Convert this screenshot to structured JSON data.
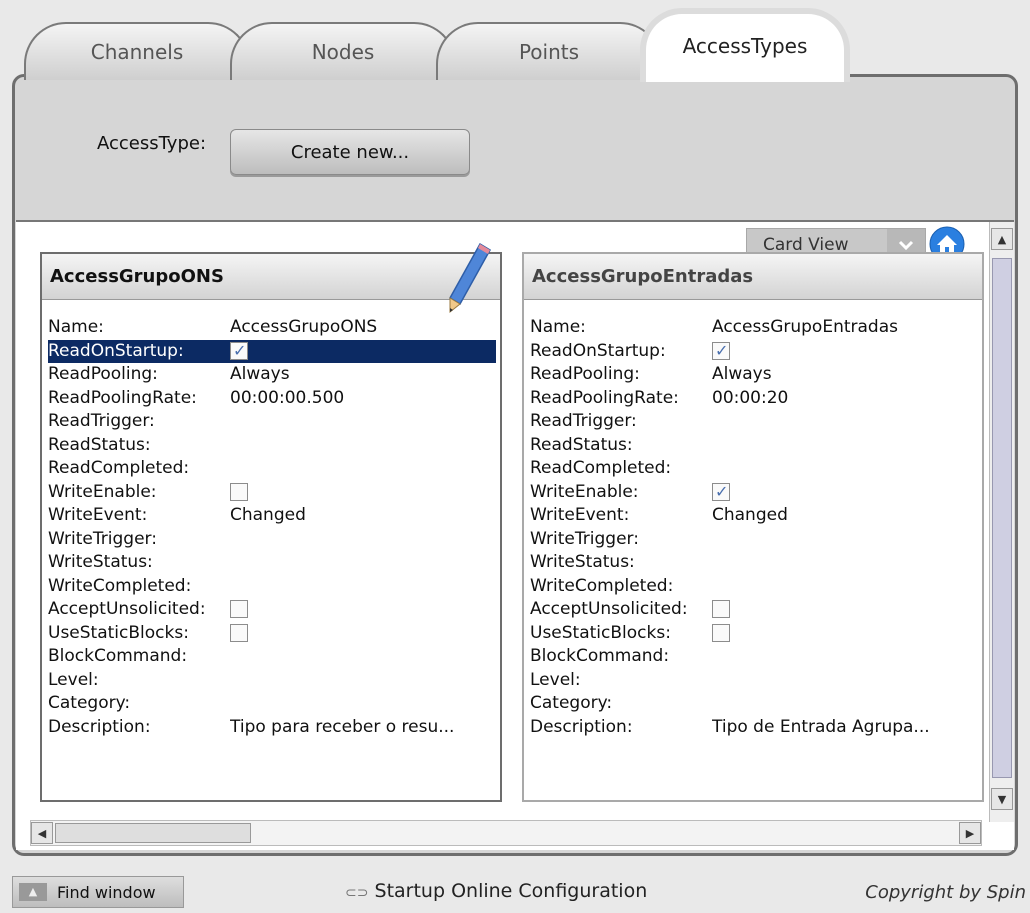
{
  "tabs": [
    "Channels",
    "Nodes",
    "Points",
    "AccessTypes"
  ],
  "accesstype_label": "AccessType:",
  "create_button": "Create new...",
  "view_selector": "Card View",
  "cards": [
    {
      "title": "AccessGrupoONS",
      "rows": [
        {
          "label": "Name:",
          "value": "AccessGrupoONS"
        },
        {
          "label": "ReadOnStartup:",
          "checkbox": true
        },
        {
          "label": "ReadPooling:",
          "value": "Always"
        },
        {
          "label": "ReadPoolingRate:",
          "value": "00:00:00.500"
        },
        {
          "label": "ReadTrigger:",
          "value": ""
        },
        {
          "label": "ReadStatus:",
          "value": ""
        },
        {
          "label": "ReadCompleted:",
          "value": ""
        },
        {
          "label": "WriteEnable:",
          "checkbox": false
        },
        {
          "label": "WriteEvent:",
          "value": "Changed"
        },
        {
          "label": "WriteTrigger:",
          "value": ""
        },
        {
          "label": "WriteStatus:",
          "value": ""
        },
        {
          "label": "WriteCompleted:",
          "value": ""
        },
        {
          "label": "AcceptUnsolicited:",
          "checkbox": false
        },
        {
          "label": "UseStaticBlocks:",
          "checkbox": false
        },
        {
          "label": "BlockCommand:",
          "value": ""
        },
        {
          "label": "Level:",
          "value": ""
        },
        {
          "label": "Category:",
          "value": ""
        },
        {
          "label": "Description:",
          "value": "Tipo para receber o resu..."
        }
      ]
    },
    {
      "title": "AccessGrupoEntradas",
      "rows": [
        {
          "label": "Name:",
          "value": "AccessGrupoEntradas"
        },
        {
          "label": "ReadOnStartup:",
          "checkbox": true
        },
        {
          "label": "ReadPooling:",
          "value": "Always"
        },
        {
          "label": "ReadPoolingRate:",
          "value": "00:00:20"
        },
        {
          "label": "ReadTrigger:",
          "value": ""
        },
        {
          "label": "ReadStatus:",
          "value": ""
        },
        {
          "label": "ReadCompleted:",
          "value": ""
        },
        {
          "label": "WriteEnable:",
          "checkbox": true
        },
        {
          "label": "WriteEvent:",
          "value": "Changed"
        },
        {
          "label": "WriteTrigger:",
          "value": ""
        },
        {
          "label": "WriteStatus:",
          "value": ""
        },
        {
          "label": "WriteCompleted:",
          "value": ""
        },
        {
          "label": "AcceptUnsolicited:",
          "checkbox": false
        },
        {
          "label": "UseStaticBlocks:",
          "checkbox": false
        },
        {
          "label": "BlockCommand:",
          "value": ""
        },
        {
          "label": "Level:",
          "value": ""
        },
        {
          "label": "Category:",
          "value": ""
        },
        {
          "label": "Description:",
          "value": "Tipo de Entrada Agrupa..."
        }
      ]
    }
  ],
  "footer": {
    "find_window": "Find window",
    "startup": "Startup Online Configuration",
    "copyright": "Copyright by Spin"
  },
  "colors": {
    "selection": "#0c2a63",
    "home_icon": "#2a7fe0"
  }
}
